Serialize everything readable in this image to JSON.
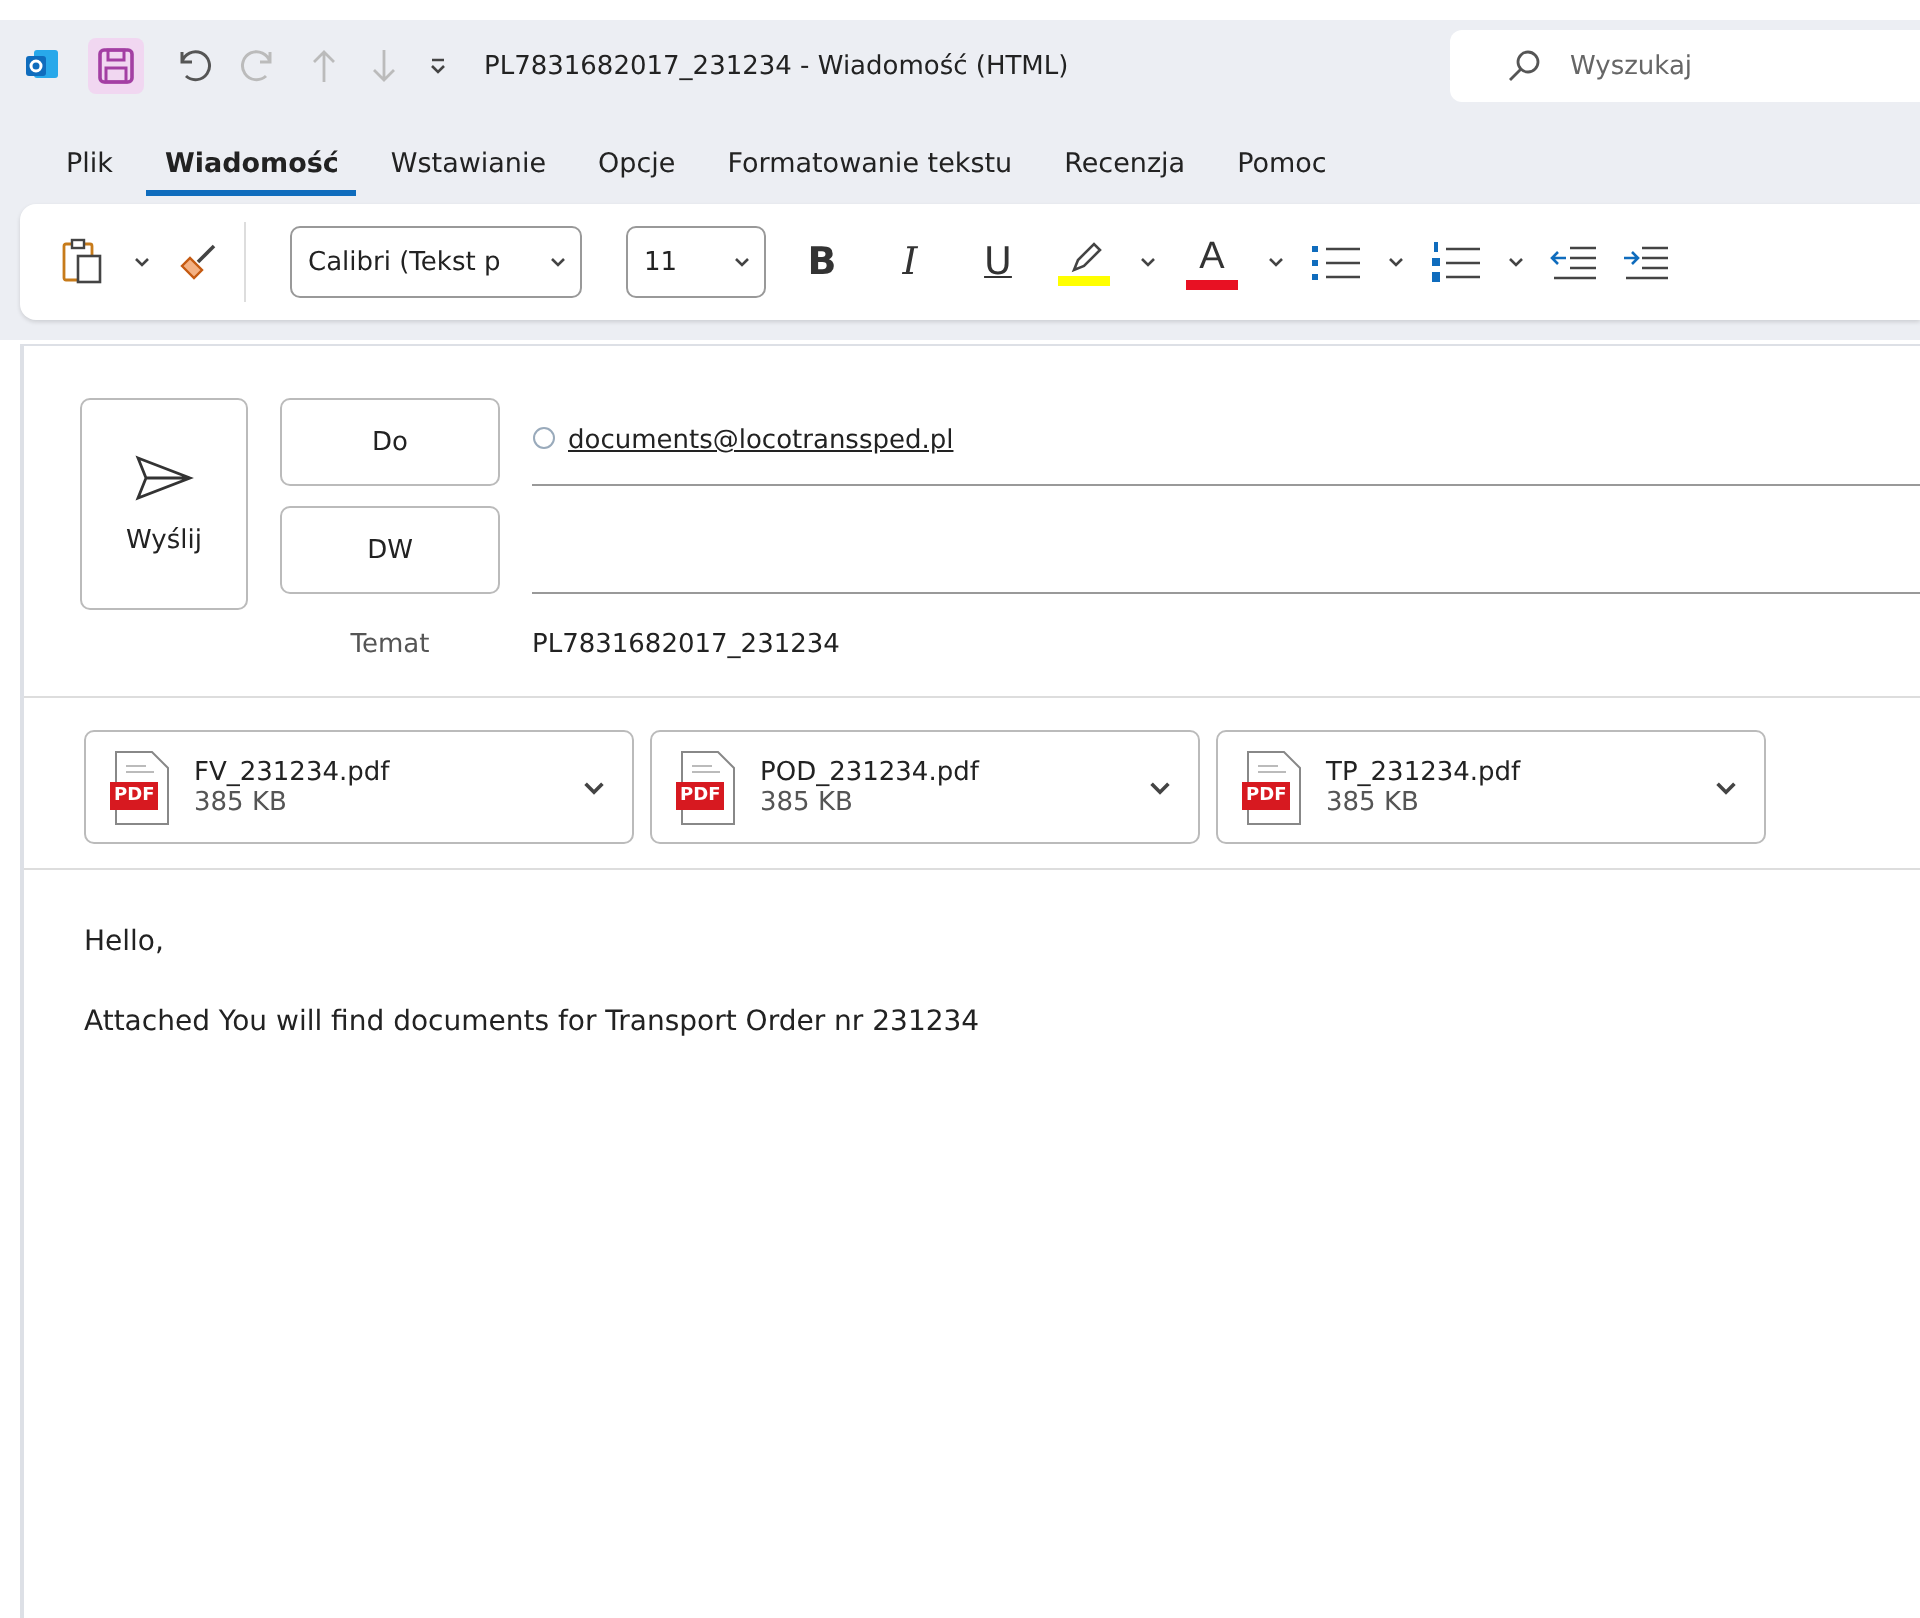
{
  "titlebar": {
    "title": "PL7831682017_231234  -  Wiadomość (HTML)",
    "search": {
      "placeholder": "Wyszukaj"
    }
  },
  "tabs": [
    {
      "label": "Plik",
      "selected": false
    },
    {
      "label": "Wiadomość",
      "selected": true
    },
    {
      "label": "Wstawianie",
      "selected": false
    },
    {
      "label": "Opcje",
      "selected": false
    },
    {
      "label": "Formatowanie tekstu",
      "selected": false
    },
    {
      "label": "Recenzja",
      "selected": false
    },
    {
      "label": "Pomoc",
      "selected": false
    }
  ],
  "ribbon": {
    "font": "Calibri (Tekst p",
    "size": "11",
    "format_buttons": [
      {
        "kind": "bold",
        "glyph": "B"
      },
      {
        "kind": "italic",
        "glyph": "I"
      },
      {
        "kind": "underline",
        "glyph": "U"
      }
    ],
    "font_color": {
      "glyph": "A",
      "color": "#e81123"
    },
    "highlight": {
      "color": "#ffff00"
    }
  },
  "compose": {
    "send": "Wyślij",
    "to_button": "Do",
    "cc_button": "DW",
    "to": "documents@locotranssped.pl",
    "subject_label": "Temat",
    "subject": "PL7831682017_231234"
  },
  "attachments": [
    {
      "name": "FV_231234.pdf",
      "size": "385 KB",
      "badge": "PDF"
    },
    {
      "name": "POD_231234.pdf",
      "size": "385 KB",
      "badge": "PDF"
    },
    {
      "name": "TP_231234.pdf",
      "size": "385 KB",
      "badge": "PDF"
    }
  ],
  "body": [
    "Hello,",
    "Attached You will find documents for Transport Order nr 231234"
  ]
}
